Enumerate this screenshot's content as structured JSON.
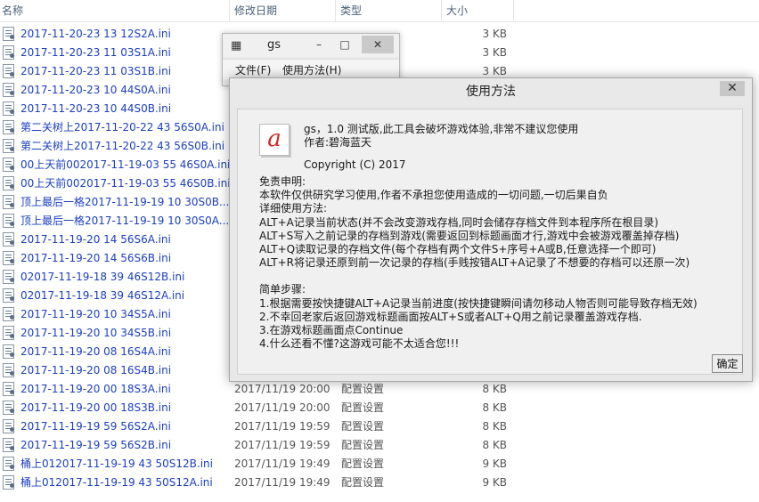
{
  "explorer": {
    "columns": {
      "name": "名称",
      "date": "修改日期",
      "type": "类型",
      "size": "大小"
    },
    "rows": [
      {
        "name": "2017-11-20-23 13 12S2A.ini",
        "date": "",
        "type": "",
        "size": "3 KB"
      },
      {
        "name": "2017-11-20-23 11 03S1A.ini",
        "date": "",
        "type": "",
        "size": "3 KB"
      },
      {
        "name": "2017-11-20-23 11 03S1B.ini",
        "date": "",
        "type": "",
        "size": "3 KB"
      },
      {
        "name": "2017-11-20-23 10 44S0A.ini",
        "date": "",
        "type": "",
        "size": ""
      },
      {
        "name": "2017-11-20-23 10 44S0B.ini",
        "date": "",
        "type": "",
        "size": ""
      },
      {
        "name": "第二关树上2017-11-20-22 43 56S0A.ini",
        "date": "",
        "type": "",
        "size": ""
      },
      {
        "name": "第二关树上2017-11-20-22 43 56S0B.ini",
        "date": "",
        "type": "",
        "size": ""
      },
      {
        "name": "00上天前002017-11-19-03 55 46S0A.ini",
        "date": "",
        "type": "",
        "size": ""
      },
      {
        "name": "00上天前002017-11-19-03 55 46S0B.ini",
        "date": "",
        "type": "",
        "size": ""
      },
      {
        "name": "顶上最后一格2017-11-19-19 10 30S0B...",
        "date": "",
        "type": "",
        "size": ""
      },
      {
        "name": "顶上最后一格2017-11-19-19 10 30S0A...",
        "date": "",
        "type": "",
        "size": ""
      },
      {
        "name": "2017-11-19-20 14 56S6A.ini",
        "date": "",
        "type": "",
        "size": ""
      },
      {
        "name": "2017-11-19-20 14 56S6B.ini",
        "date": "",
        "type": "",
        "size": ""
      },
      {
        "name": "02017-11-19-18 39 46S12B.ini",
        "date": "",
        "type": "",
        "size": ""
      },
      {
        "name": "02017-11-19-18 39 46S12A.ini",
        "date": "",
        "type": "",
        "size": ""
      },
      {
        "name": "2017-11-19-20 10 34S5A.ini",
        "date": "",
        "type": "",
        "size": ""
      },
      {
        "name": "2017-11-19-20 10 34S5B.ini",
        "date": "",
        "type": "",
        "size": ""
      },
      {
        "name": "2017-11-19-20 08 16S4A.ini",
        "date": "",
        "type": "",
        "size": ""
      },
      {
        "name": "2017-11-19-20 08 16S4B.ini",
        "date": "",
        "type": "",
        "size": ""
      },
      {
        "name": "2017-11-19-20 00 18S3A.ini",
        "date": "2017/11/19 20:00",
        "type": "配置设置",
        "size": "8 KB"
      },
      {
        "name": "2017-11-19-20 00 18S3B.ini",
        "date": "2017/11/19 20:00",
        "type": "配置设置",
        "size": "8 KB"
      },
      {
        "name": "2017-11-19-19 59 56S2A.ini",
        "date": "2017/11/19 19:59",
        "type": "配置设置",
        "size": "8 KB"
      },
      {
        "name": "2017-11-19-19 59 56S2B.ini",
        "date": "2017/11/19 19:59",
        "type": "配置设置",
        "size": "8 KB"
      },
      {
        "name": "桶上012017-11-19-19 43 50S12B.ini",
        "date": "2017/11/19 19:49",
        "type": "配置设置",
        "size": "9 KB"
      },
      {
        "name": "桶上012017-11-19-19 43 50S12A.ini",
        "date": "2017/11/19 19:49",
        "type": "配置设置",
        "size": "9 KB"
      }
    ]
  },
  "gs_window": {
    "title": "gs",
    "min": "–",
    "max": "□",
    "close": "✕",
    "menu": [
      "文件(F)",
      "使用方法(H)"
    ]
  },
  "dialog": {
    "title": "使用方法",
    "close": "✕",
    "logo": "a",
    "version": "gs，1.0 测试版,此工具会破坏游戏体验,非常不建议您使用",
    "author": "作者:碧海蓝天",
    "copyright": "Copyright (C) 2017",
    "lines": [
      "免责申明:",
      "本软件仅供研究学习使用,作者不承担您使用造成的一切问题,一切后果自负",
      "详细使用方法:",
      "ALT+A记录当前状态(并不会改变游戏存档,同时会储存存档文件到本程序所在根目录)",
      "ALT+S写入之前记录的存档到游戏(需要返回到标题画面才行,游戏中会被游戏覆盖掉存档)",
      "ALT+Q读取记录的存档文件(每个存档有两个文件S+序号+A或B,任意选择一个即可)",
      "ALT+R将记录还原到前一次记录的存档(手贱按错ALT+A记录了不想要的存档可以还原一次)",
      "",
      "简单步骤:",
      "1.根据需要按快捷键ALT+A记录当前进度(按快捷键瞬间请勿移动人物否则可能导致存档无效)",
      "2.不幸回老家后返回游戏标题画面按ALT+S或者ALT+Q用之前记录覆盖游戏存档.",
      "3.在游戏标题画面点Continue",
      "4.什么还看不懂?这游戏可能不太适合您!!!"
    ],
    "ok": "确定"
  }
}
